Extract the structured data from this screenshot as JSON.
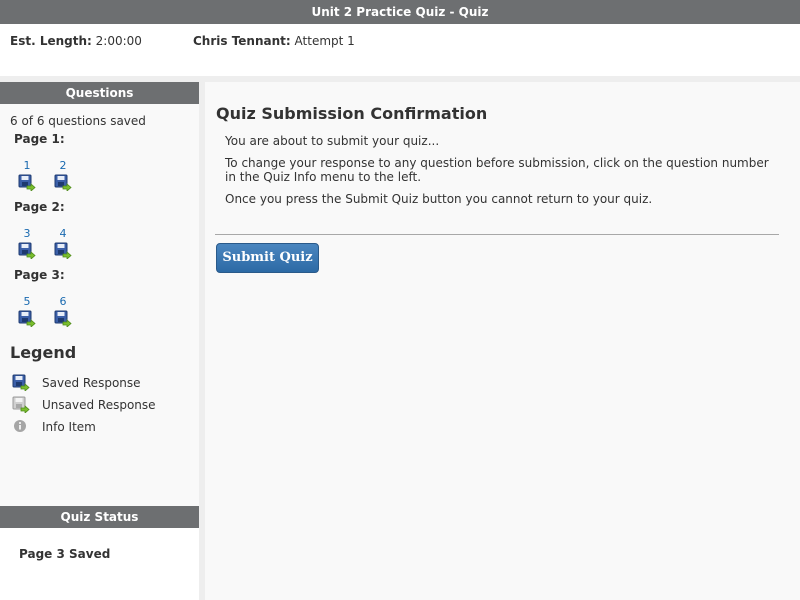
{
  "title": "Unit 2 Practice Quiz - Quiz",
  "info": {
    "length_label": "Est. Length:",
    "length_value": "2:00:00",
    "user_label": "Chris Tennant:",
    "user_value": "Attempt 1"
  },
  "questions_panel": {
    "header": "Questions",
    "saved_count": "6 of 6 questions saved",
    "pages": [
      {
        "label": "Page 1:",
        "questions": [
          "1",
          "2"
        ]
      },
      {
        "label": "Page 2:",
        "questions": [
          "3",
          "4"
        ]
      },
      {
        "label": "Page 3:",
        "questions": [
          "5",
          "6"
        ]
      }
    ]
  },
  "legend": {
    "title": "Legend",
    "items": [
      {
        "label": "Saved Response",
        "icon": "saved-response-icon"
      },
      {
        "label": "Unsaved Response",
        "icon": "unsaved-response-icon"
      },
      {
        "label": "Info Item",
        "icon": "info-icon"
      }
    ]
  },
  "quiz_status": {
    "header": "Quiz Status",
    "text": "Page 3 Saved"
  },
  "main": {
    "heading": "Quiz Submission Confirmation",
    "messages": [
      "You are about to submit your quiz...",
      "To change your response to any question before submission, click on the question number in the Quiz Info menu to the left.",
      "Once you press the Submit Quiz button you cannot return to your quiz."
    ],
    "submit_label": "Submit Quiz"
  },
  "colors": {
    "header_bg": "#6d6f71",
    "link": "#1a6ab0",
    "button": "#2c6aa5"
  }
}
